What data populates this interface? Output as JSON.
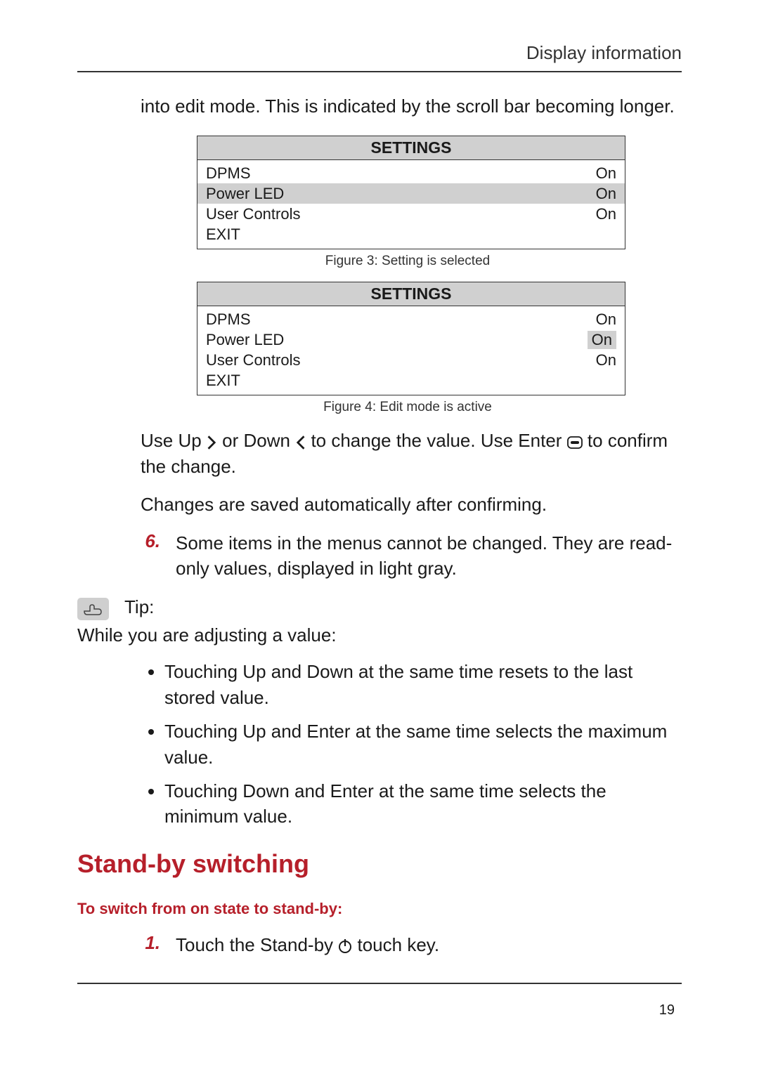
{
  "header": {
    "title": "Display information"
  },
  "intro_paragraph": "into edit mode. This is indicated by the scroll bar becoming longer.",
  "tables": {
    "title": "SETTINGS",
    "rows": [
      {
        "label": "DPMS",
        "value": "On"
      },
      {
        "label": "Power LED",
        "value": "On"
      },
      {
        "label": "User Controls",
        "value": "On"
      },
      {
        "label": "EXIT",
        "value": ""
      }
    ]
  },
  "fig3_caption": "Figure 3: Setting is selected",
  "fig4_caption": "Figure 4: Edit mode is active",
  "instr1_a": "Use Up ",
  "instr1_b": " or Down ",
  "instr1_c": " to change the value. Use Enter ",
  "instr1_d": " to confirm the change.",
  "instr2": "Changes are saved automatically after confirming.",
  "step6_num": "6.",
  "step6_text": "Some items in the menus cannot be changed. They are read-only values, displayed in light gray.",
  "tip_label": "Tip:",
  "while_text": "While you are adjusting a value:",
  "bullets": [
    "Touching Up and Down at the same time resets to the last stored value.",
    "Touching Up and Enter at the same time selects the maximum value.",
    "Touching Down and Enter at the same time selects the minimum value."
  ],
  "h2": "Stand-by switching",
  "h4": "To switch from on state to stand-by:",
  "step1_num": "1.",
  "step1_a": "Touch the Stand-by ",
  "step1_b": " touch key.",
  "page_number": "19"
}
